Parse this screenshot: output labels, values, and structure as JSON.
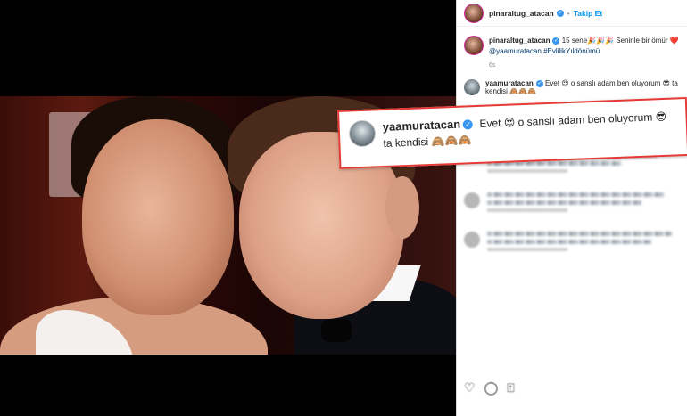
{
  "post": {
    "author": "pinaraltug_atacan",
    "follow_label": "Takip Et",
    "separator": "•"
  },
  "caption": {
    "author": "pinaraltug_atacan",
    "text": "15 sene🎉🎉🎉 Seninle bir ömür ❤️",
    "mention": "@yaamuratacan",
    "hashtag": "#EvlilikYıldönümü",
    "time": "6s"
  },
  "comment": {
    "author": "yaamuratacan",
    "text": "Evet 😍 o sanslı adam ben oluyorum 😎 ta kendisi 🙈🙈🙈"
  },
  "callout": {
    "author": "yaamuratacan",
    "text": "Evet 😍 o sanslı adam ben oluyorum 😎 ta kendisi 🙈🙈🙈"
  },
  "colors": {
    "callout_border": "#e53935",
    "verified": "#3897f0",
    "follow": "#0095f6"
  },
  "icons": [
    "heart-icon",
    "comment-icon",
    "share-icon"
  ]
}
